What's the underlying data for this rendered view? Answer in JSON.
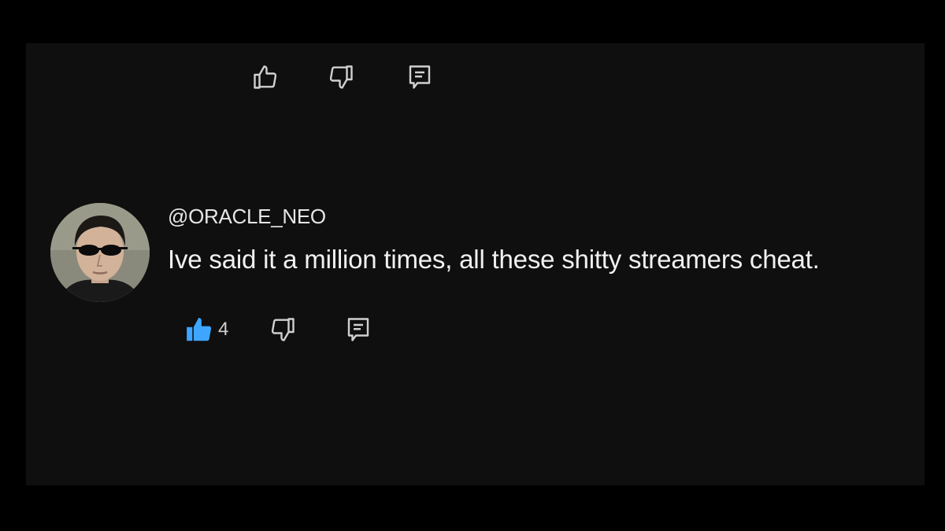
{
  "top_actions": {
    "like_icon": "thumb-up-outline-icon",
    "dislike_icon": "thumb-down-outline-icon",
    "reply_icon": "reply-comment-icon"
  },
  "comment": {
    "author": "@ORACLE_NEO",
    "text": "Ive said it a million times, all these shitty streamers cheat.",
    "like_count": "4",
    "liked": true,
    "avatar_icon": "avatar-man-sunglasses"
  },
  "colors": {
    "background": "#000000",
    "panel": "#0f0f0f",
    "text_primary": "#f1f1f1",
    "icon": "#d0d0d0",
    "liked_accent": "#3ea6ff"
  }
}
